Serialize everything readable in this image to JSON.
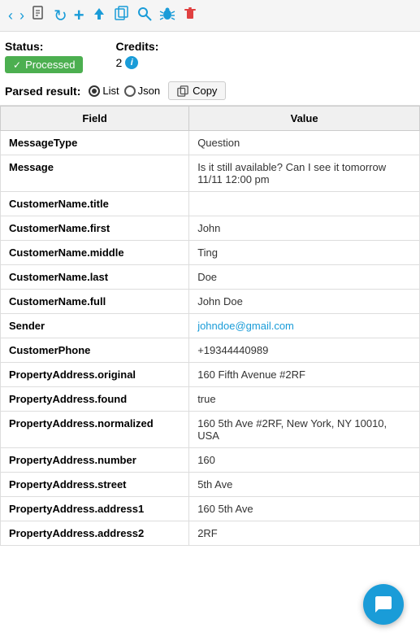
{
  "toolbar": {
    "icons": [
      {
        "name": "back-icon",
        "symbol": "‹",
        "color": "blue"
      },
      {
        "name": "forward-icon",
        "symbol": "›",
        "color": "blue"
      },
      {
        "name": "document-icon",
        "symbol": "📄",
        "color": ""
      },
      {
        "name": "refresh-icon",
        "symbol": "↻",
        "color": "blue"
      },
      {
        "name": "add-icon",
        "symbol": "+",
        "color": "blue"
      },
      {
        "name": "upload-icon",
        "symbol": "▲",
        "color": "blue"
      },
      {
        "name": "copy-doc-icon",
        "symbol": "⧉",
        "color": "blue"
      },
      {
        "name": "search-icon",
        "symbol": "🔍",
        "color": "blue"
      },
      {
        "name": "bug-icon",
        "symbol": "🐛",
        "color": "blue"
      },
      {
        "name": "delete-icon",
        "symbol": "🗑",
        "color": "red"
      }
    ]
  },
  "status": {
    "label": "Status:",
    "badge_text": "Processed"
  },
  "credits": {
    "label": "Credits:",
    "value": "2"
  },
  "parsed_result": {
    "label": "Parsed result:",
    "radio_list": "List",
    "radio_json": "Json",
    "copy_button": "Copy"
  },
  "table": {
    "col_field": "Field",
    "col_value": "Value",
    "rows": [
      {
        "field": "MessageType",
        "value": "Question",
        "is_email": false
      },
      {
        "field": "Message",
        "value": "Is it still available? Can I see it tomorrow 11/11 12:00 pm",
        "is_email": false
      },
      {
        "field": "CustomerName.title",
        "value": "",
        "is_email": false
      },
      {
        "field": "CustomerName.first",
        "value": "John",
        "is_email": false
      },
      {
        "field": "CustomerName.middle",
        "value": "Ting",
        "is_email": false
      },
      {
        "field": "CustomerName.last",
        "value": "Doe",
        "is_email": false
      },
      {
        "field": "CustomerName.full",
        "value": "John Doe",
        "is_email": false
      },
      {
        "field": "Sender",
        "value": "johndoe@gmail.com",
        "is_email": true
      },
      {
        "field": "CustomerPhone",
        "value": "+19344440989",
        "is_email": false
      },
      {
        "field": "PropertyAddress.original",
        "value": "160 Fifth Avenue #2RF",
        "is_email": false
      },
      {
        "field": "PropertyAddress.found",
        "value": "true",
        "is_email": false
      },
      {
        "field": "PropertyAddress.normalized",
        "value": "160 5th Ave #2RF, New York, NY 10010, USA",
        "is_email": false
      },
      {
        "field": "PropertyAddress.number",
        "value": "160",
        "is_email": false
      },
      {
        "field": "PropertyAddress.street",
        "value": "5th Ave",
        "is_email": false
      },
      {
        "field": "PropertyAddress.address1",
        "value": "160 5th Ave",
        "is_email": false
      },
      {
        "field": "PropertyAddress.address2",
        "value": "2RF",
        "is_email": false
      }
    ]
  }
}
